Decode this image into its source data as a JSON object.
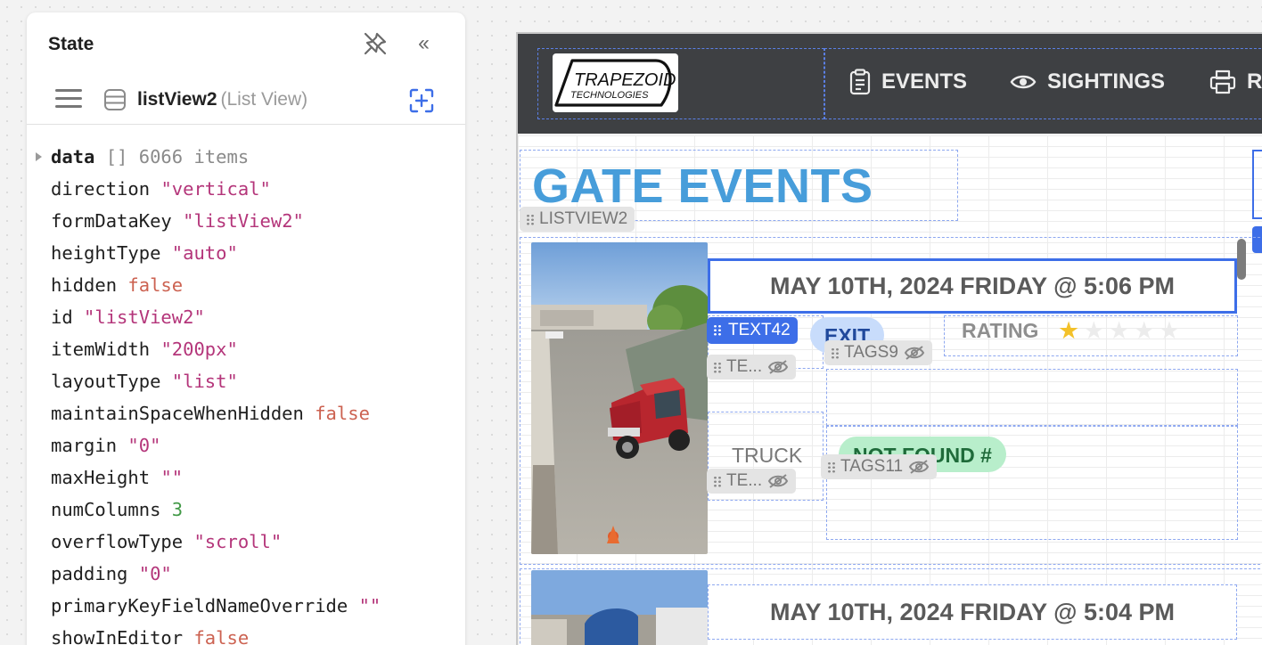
{
  "state_panel": {
    "title": "State",
    "component_id": "listView2",
    "component_type": "(List View)",
    "properties": [
      {
        "key": "data",
        "value": "[]",
        "extra": "6066 items",
        "type": "meta",
        "expandable": true
      },
      {
        "key": "direction",
        "value": "\"vertical\"",
        "type": "string"
      },
      {
        "key": "formDataKey",
        "value": "\"listView2\"",
        "type": "string"
      },
      {
        "key": "heightType",
        "value": "\"auto\"",
        "type": "string"
      },
      {
        "key": "hidden",
        "value": "false",
        "type": "bool"
      },
      {
        "key": "id",
        "value": "\"listView2\"",
        "type": "string"
      },
      {
        "key": "itemWidth",
        "value": "\"200px\"",
        "type": "string"
      },
      {
        "key": "layoutType",
        "value": "\"list\"",
        "type": "string"
      },
      {
        "key": "maintainSpaceWhenHidden",
        "value": "false",
        "type": "bool"
      },
      {
        "key": "margin",
        "value": "\"0\"",
        "type": "string"
      },
      {
        "key": "maxHeight",
        "value": "\"\"",
        "type": "string"
      },
      {
        "key": "numColumns",
        "value": "3",
        "type": "number"
      },
      {
        "key": "overflowType",
        "value": "\"scroll\"",
        "type": "string"
      },
      {
        "key": "padding",
        "value": "\"0\"",
        "type": "string"
      },
      {
        "key": "primaryKeyFieldNameOverride",
        "value": "\"\"",
        "type": "string"
      },
      {
        "key": "showInEditor",
        "value": "false",
        "type": "bool"
      }
    ]
  },
  "app": {
    "logo": {
      "line1": "TRAPEZOID",
      "line2": "TECHNOLOGIES"
    },
    "nav": [
      {
        "label": "EVENTS",
        "icon": "clipboard-icon"
      },
      {
        "label": "SIGHTINGS",
        "icon": "eye-icon"
      },
      {
        "label": "RE",
        "icon": "printer-icon"
      }
    ],
    "page_title": "GATE EVENTS",
    "listview_tag": "LISTVIEW2",
    "rows": [
      {
        "date": "MAY 10TH, 2024 FRIDAY @ 5:06 PM",
        "direction_pill": "EXIT",
        "rating_label": "RATING",
        "rating": 1,
        "rating_max": 5,
        "vehicle_type": "TRUCK",
        "plate_pill": "NOT FOUND #",
        "tags": {
          "text42": "TEXT42",
          "tags9": "TAGS9",
          "tags11": "TAGS11",
          "te1": "TE...",
          "te2": "TE..."
        }
      },
      {
        "date": "MAY 10TH, 2024 FRIDAY @ 5:04 PM"
      }
    ]
  },
  "colors": {
    "accent": "#3d6ee8",
    "title_blue": "#479dda",
    "header_bg": "#3e4043",
    "string_value": "#b4357a",
    "bool_value": "#cc6251",
    "number_value": "#429947"
  }
}
